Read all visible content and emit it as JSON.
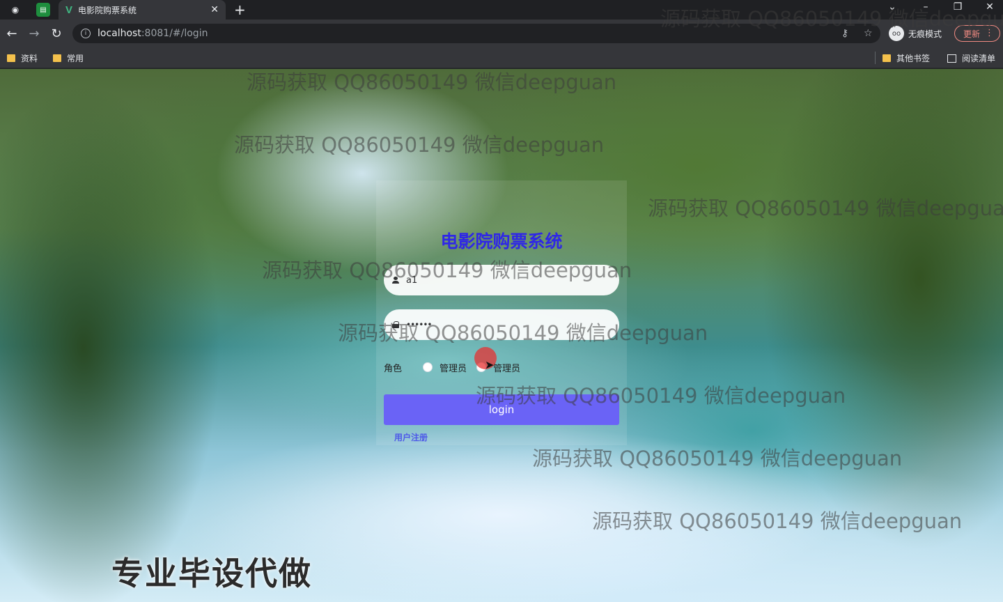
{
  "browser": {
    "tab_title": "电影院购票系统",
    "tab_favicon": "V",
    "url_host": "localhost",
    "url_rest": ":8081/#/login",
    "incognito_label": "无痕模式",
    "update_label": "更新",
    "bookmarks": [
      "资料",
      "常用"
    ],
    "other_bookmarks": "其他书签",
    "reading_list": "阅读清单"
  },
  "login": {
    "title": "电影院购票系统",
    "username_value": "a1",
    "password_value": "••••••",
    "role_label": "角色",
    "role_options": [
      "管理员",
      "管理员"
    ],
    "submit_label": "login",
    "register_link": "用户注册"
  },
  "overlay": {
    "watermark_text": "源码获取 QQ86050149 微信deepguan",
    "promo_text": "专业毕设代做"
  }
}
